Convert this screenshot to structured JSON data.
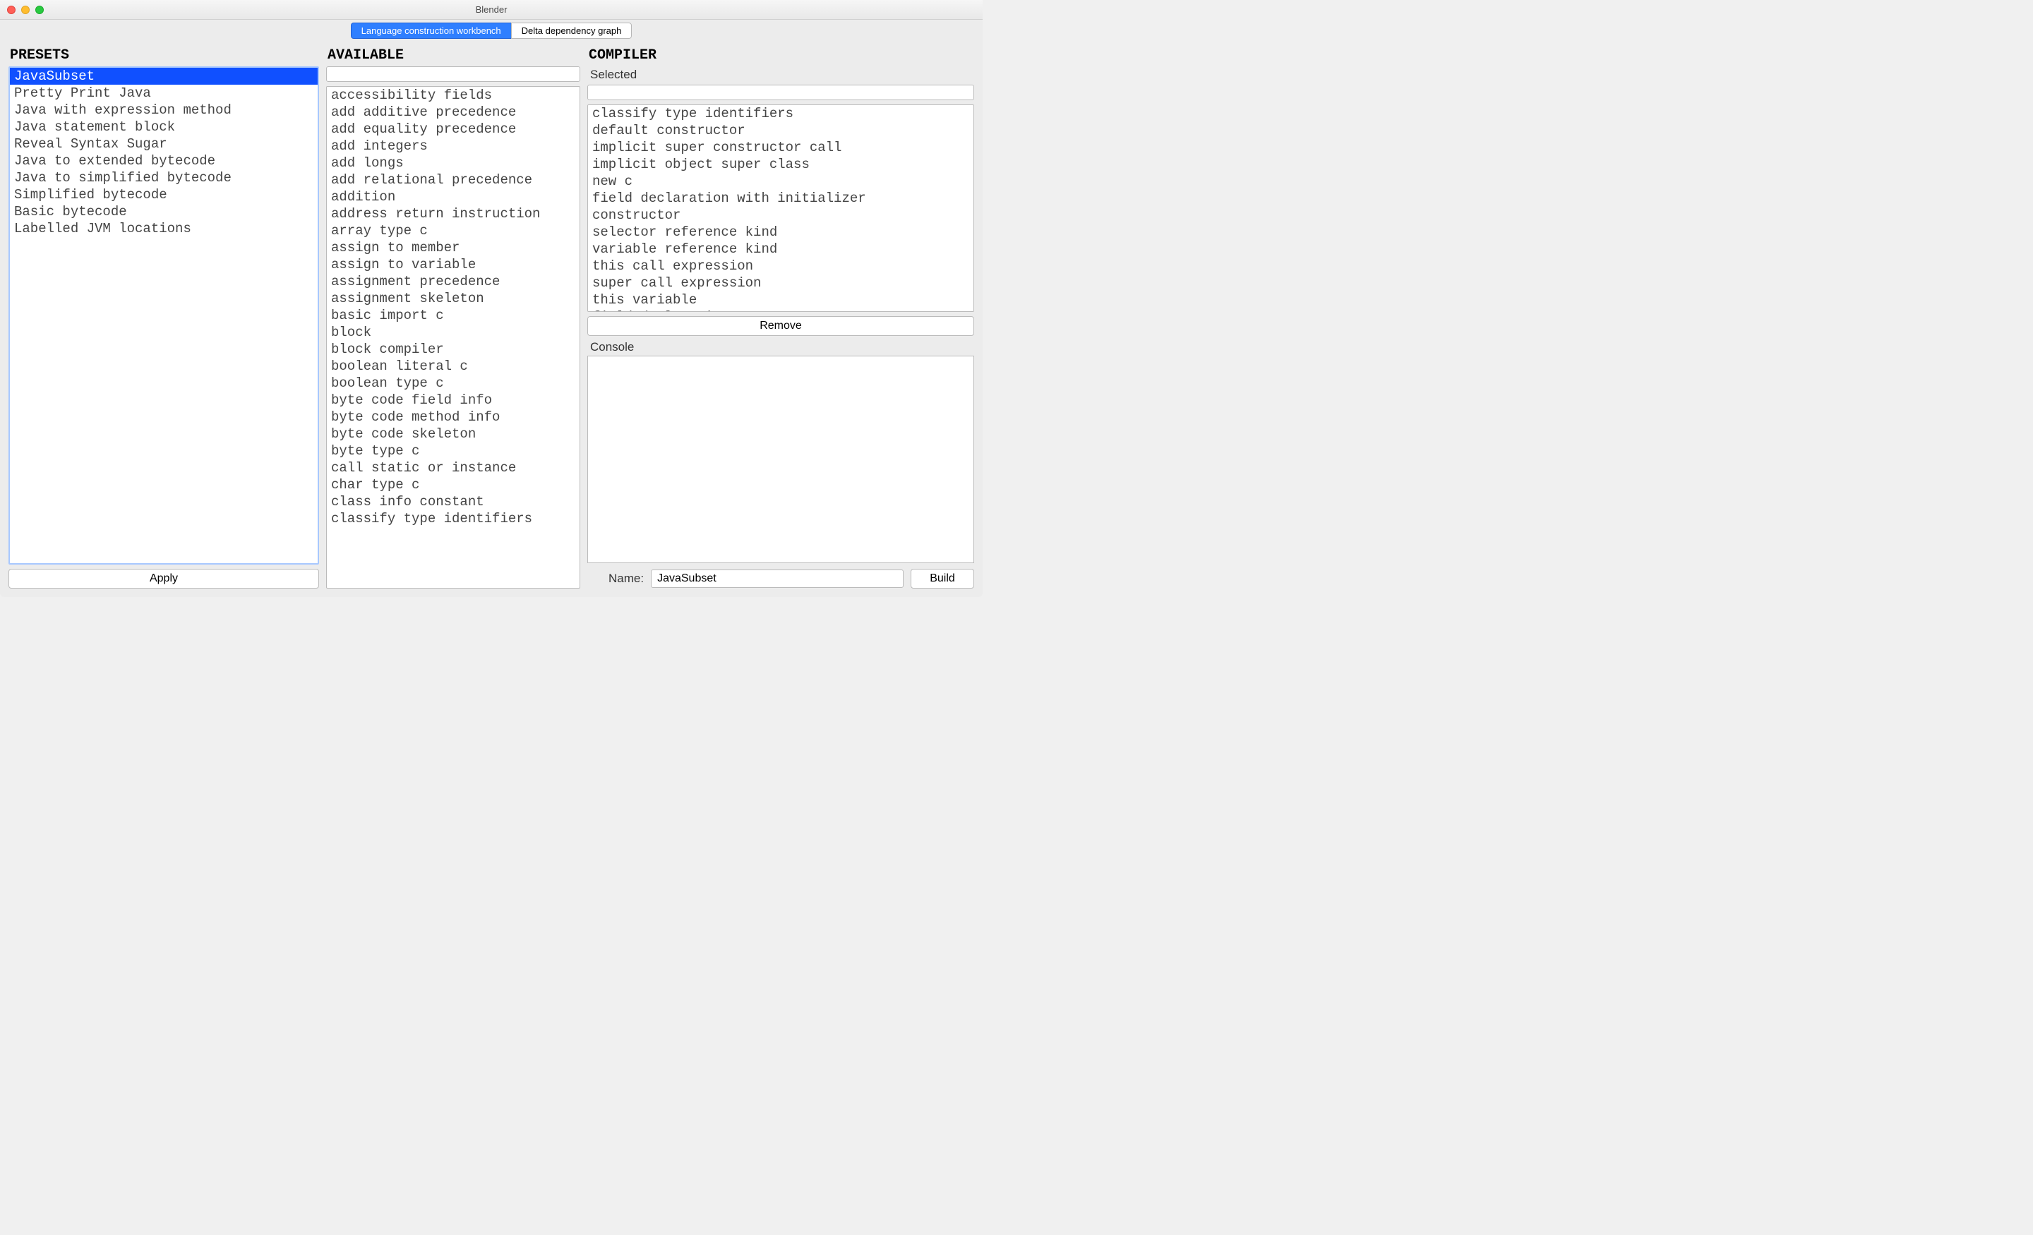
{
  "window": {
    "title": "Blender"
  },
  "tabs": [
    {
      "label": "Language construction workbench",
      "active": true
    },
    {
      "label": "Delta dependency graph",
      "active": false
    }
  ],
  "presets": {
    "header": "PRESETS",
    "items": [
      "JavaSubset",
      "Pretty Print Java",
      "Java with expression method",
      "Java statement block",
      "Reveal Syntax Sugar",
      "Java to extended bytecode",
      "Java to simplified bytecode",
      "Simplified bytecode",
      "Basic bytecode",
      "Labelled JVM locations"
    ],
    "selected_index": 0,
    "apply_label": "Apply"
  },
  "available": {
    "header": "AVAILABLE",
    "search": "",
    "items": [
      "accessibility fields",
      "add additive precedence",
      "add equality precedence",
      "add integers",
      "add longs",
      "add relational precedence",
      "addition",
      "address return instruction",
      "array type c",
      "assign to member",
      "assign to variable",
      "assignment precedence",
      "assignment skeleton",
      "basic import c",
      "block",
      "block compiler",
      "boolean literal c",
      "boolean type c",
      "byte code field info",
      "byte code method info",
      "byte code skeleton",
      "byte type c",
      "call static or instance",
      "char type c",
      "class info constant",
      "classify type identifiers"
    ]
  },
  "compiler": {
    "header": "COMPILER",
    "selected_label": "Selected",
    "search": "",
    "items": [
      "classify type identifiers",
      "default constructor",
      "implicit super constructor call",
      "implicit object super class",
      "new c",
      "field declaration with initializer",
      "constructor",
      "selector reference kind",
      "variable reference kind",
      "this call expression",
      "super call expression",
      "this variable",
      "field declaration"
    ],
    "remove_label": "Remove",
    "console_label": "Console",
    "name_label": "Name:",
    "name_value": "JavaSubset",
    "build_label": "Build"
  }
}
